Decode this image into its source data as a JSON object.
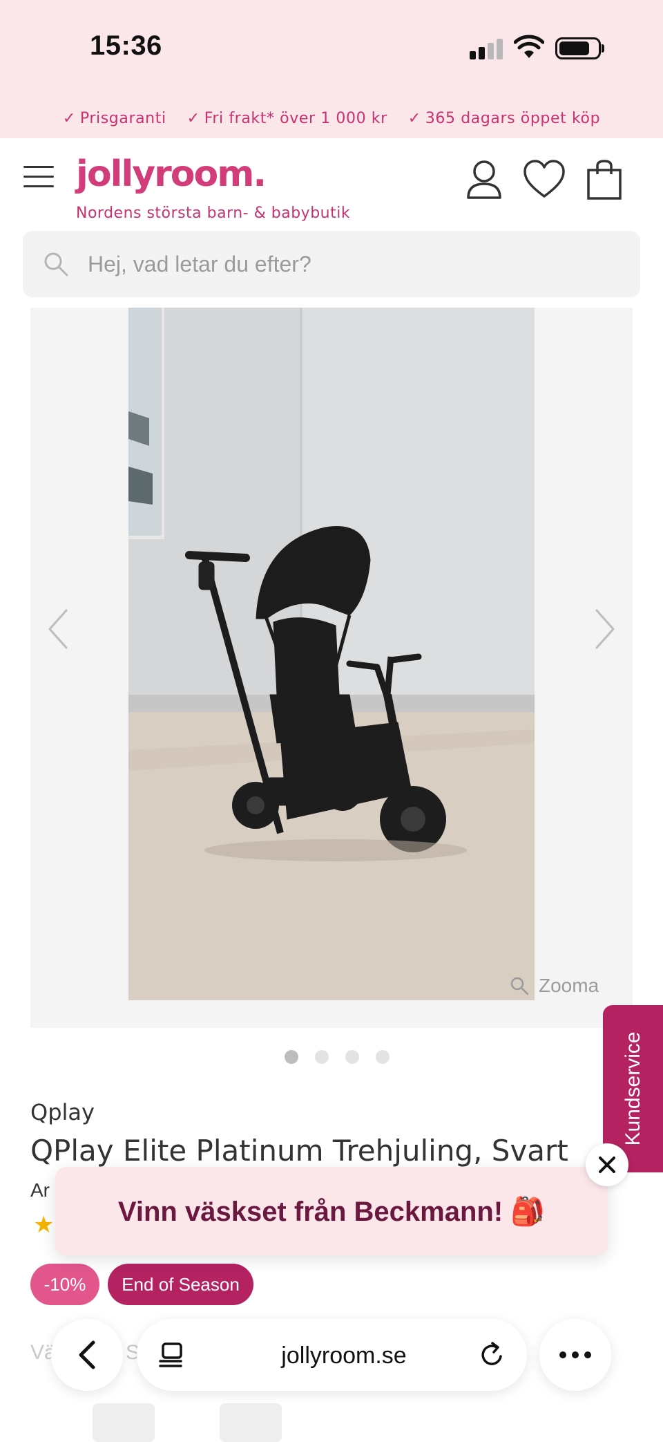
{
  "status": {
    "time": "15:36"
  },
  "usp": [
    {
      "label": "Prisgaranti"
    },
    {
      "label": "Fri frakt* över 1 000 kr"
    },
    {
      "label": "365 dagars öppet köp"
    }
  ],
  "header": {
    "logo": "jollyroom.",
    "tagline": "Nordens största barn- & babybutik",
    "icons": [
      "menu-icon",
      "account-icon",
      "heart-icon",
      "bag-icon"
    ]
  },
  "search": {
    "placeholder": "Hej, vad letar du efter?"
  },
  "gallery": {
    "zoom_label": "Zooma",
    "image_count": 4,
    "active_index": 0
  },
  "product": {
    "brand": "Qplay",
    "title": "QPlay Elite Platinum Trehjuling, Svart",
    "art_partial": "Ar",
    "rating_star": "★",
    "badges": {
      "discount": "-10%",
      "campaign": "End of Season"
    }
  },
  "kundservice": {
    "label": "Kundservice"
  },
  "popup": {
    "text": "Vinn väskset från Beckmann! 🎒"
  },
  "background_partial": {
    "text": "Vä",
    "text2": "S"
  },
  "browser": {
    "url": "jollyroom.se"
  },
  "colors": {
    "brand_pink": "#d23c79",
    "dark_pink": "#b42262",
    "discount_pink": "#e2568b",
    "light_pink_bg": "#fbe6ea",
    "popup_text": "#6b1840"
  }
}
